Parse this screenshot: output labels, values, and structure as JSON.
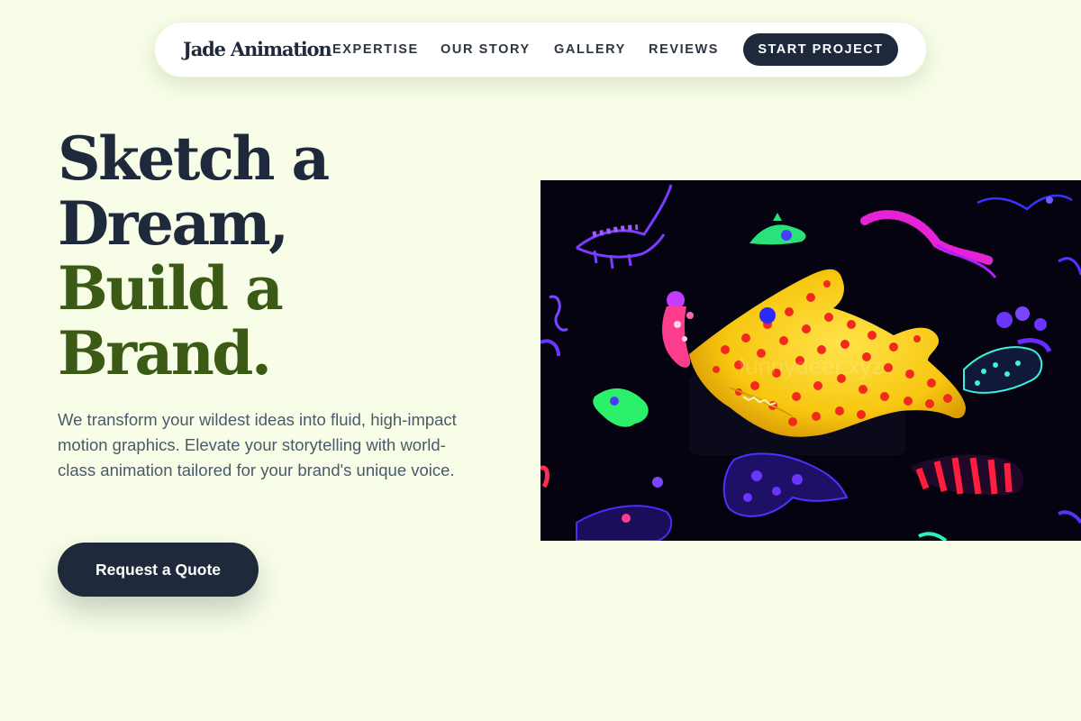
{
  "header": {
    "brand": "Jade Animation",
    "nav": [
      "EXPERTISE",
      "OUR STORY",
      "GALLERY",
      "REVIEWS"
    ],
    "cta": "START PROJECT"
  },
  "hero": {
    "title_lines": [
      "Sketch a",
      "Dream,",
      "Build a",
      "Brand."
    ],
    "subtitle": "We transform your wildest ideas into fluid, high-impact motion graphics. Elevate your storytelling with world-class animation tailored for your brand's unique voice.",
    "button": "Request a Quote",
    "image": {
      "description": "yellow polka-dot sculpture with neon creatures on black",
      "watermark": "funnydeer.xyz"
    }
  },
  "colors": {
    "background": "#f7fde6",
    "navy": "#1e293b",
    "green": "#3b5a15",
    "body_text": "#4a5a6c"
  }
}
